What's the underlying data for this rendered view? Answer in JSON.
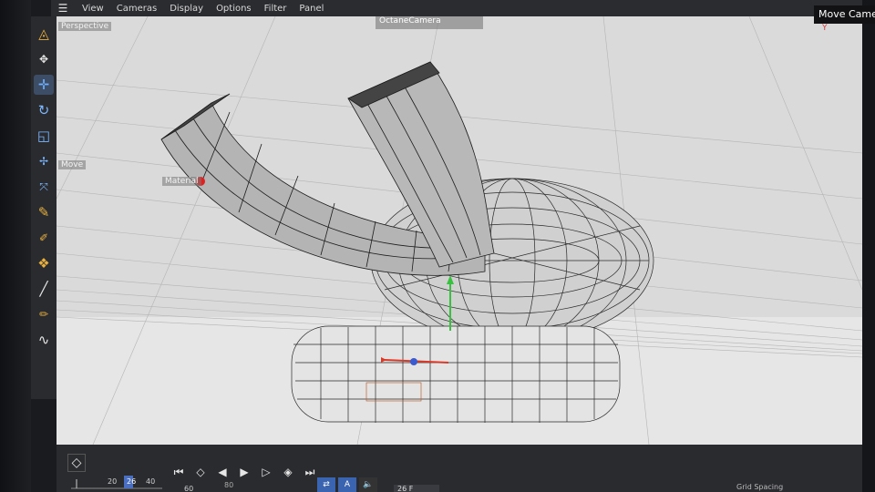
{
  "menubar": {
    "items": [
      "View",
      "Cameras",
      "Display",
      "Options",
      "Filter",
      "Panel"
    ]
  },
  "viewport": {
    "view_label": "Perspective",
    "camera_label": "OctaneCamera",
    "move_label": "Move",
    "material_label": "Material"
  },
  "topright": {
    "title": "Move Came",
    "axes": "Y"
  },
  "timeline": {
    "ticks": [
      "20",
      "26",
      "40",
      "60"
    ],
    "current_frame": "26",
    "fps_value": "26 F",
    "extra_num": "80",
    "grid_label": "Grid Spacing"
  },
  "colors": {
    "accent": "#3a64b0",
    "tool_orange": "#e8b040",
    "viewport_bg": "#d9d9d9"
  },
  "icons": {
    "toolbar": [
      "select-icon",
      "transform-tool-icon",
      "move-icon",
      "rotate-icon",
      "scale-icon",
      "axis-move-icon",
      "expand-icon",
      "spline-pen-icon",
      "knife-icon",
      "extrude-icon",
      "brush-icon",
      "sculpt-icon",
      "spline-icon"
    ],
    "transport": [
      "go-start-icon",
      "prev-key-icon",
      "step-back-icon",
      "play-icon",
      "step-forward-icon",
      "next-key-icon",
      "go-end-icon"
    ]
  }
}
